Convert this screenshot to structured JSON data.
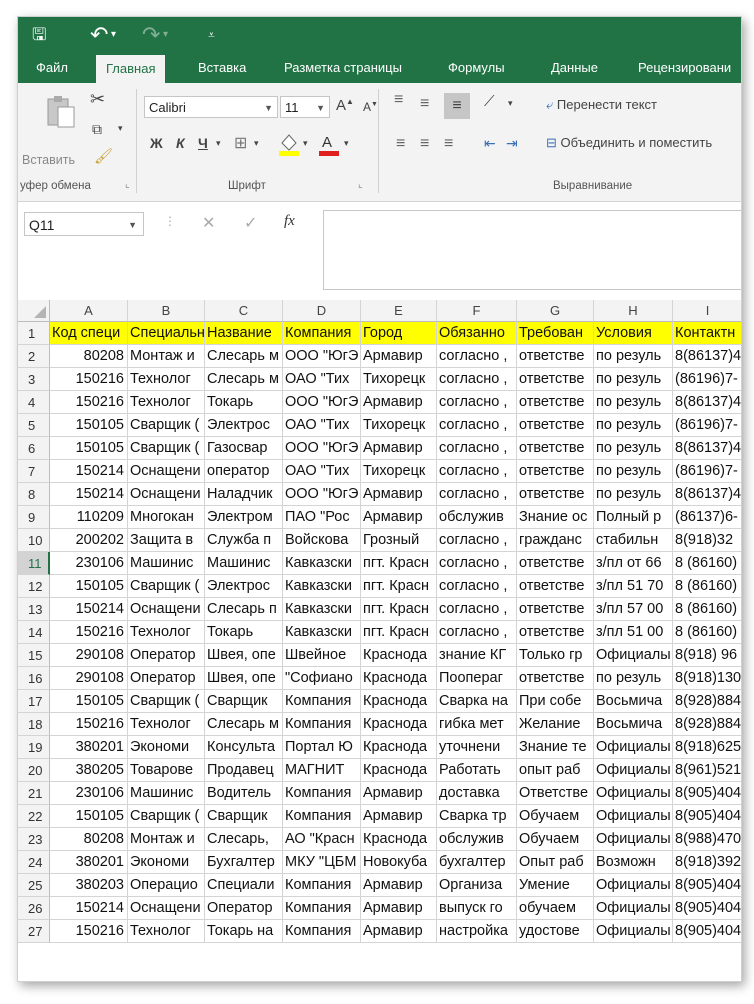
{
  "quick_access": {
    "save": "🖫",
    "undo": "↶",
    "redo": "↷",
    "customize": "▾"
  },
  "tabs": [
    {
      "label": "Файл"
    },
    {
      "label": "Главная"
    },
    {
      "label": "Вставка"
    },
    {
      "label": "Разметка страницы"
    },
    {
      "label": "Формулы"
    },
    {
      "label": "Данные"
    },
    {
      "label": "Рецензировани"
    }
  ],
  "ribbon": {
    "clipboard": {
      "paste_label": "Вставить",
      "group_label": "уфер обмена"
    },
    "font": {
      "font_name": "Calibri",
      "font_size": "11",
      "bold": "Ж",
      "italic": "К",
      "underline": "Ч",
      "grow": "A",
      "shrink": "A",
      "group_label": "Шрифт"
    },
    "alignment": {
      "wrap_text": "Перенести текст",
      "merge_center": "Объединить и поместить",
      "group_label": "Выравнивание"
    }
  },
  "formula_bar": {
    "name_box": "Q11",
    "cancel": "✕",
    "enter": "✓",
    "fx": "fx"
  },
  "grid": {
    "columns": [
      "A",
      "B",
      "C",
      "D",
      "E",
      "F",
      "G",
      "H",
      "I"
    ],
    "selected_row": 11,
    "header_row": [
      "Код специ",
      "Специальн",
      "Название",
      "Компания",
      "Город",
      "Обязанно",
      "Требован",
      "Условия",
      "Контактн"
    ],
    "rows": [
      [
        "80208",
        "Монтаж и",
        "Слесарь м",
        "ООО \"ЮгЭ",
        "Армавир",
        "согласно ,",
        "ответстве",
        "по резуль",
        "8(86137)4"
      ],
      [
        "150216",
        "Технолог",
        "Слесарь м",
        "ОАО \"Тих",
        "Тихорецк",
        "согласно ,",
        "ответстве",
        "по резуль",
        "(86196)7-"
      ],
      [
        "150216",
        "Технолог",
        "Токарь",
        "ООО \"ЮгЭ",
        "Армавир",
        "согласно ,",
        "ответстве",
        "по резуль",
        "8(86137)4"
      ],
      [
        "150105",
        "Сварщик (",
        "Электрос",
        "ОАО \"Тих",
        "Тихорецк",
        "согласно ,",
        "ответстве",
        "по резуль",
        "(86196)7-"
      ],
      [
        "150105",
        "Сварщик (",
        "Газосвар",
        "ООО \"ЮгЭ",
        "Армавир",
        "согласно ,",
        "ответстве",
        "по резуль",
        "8(86137)4"
      ],
      [
        "150214",
        "Оснащени",
        "оператор",
        "ОАО \"Тих",
        "Тихорецк",
        "согласно ,",
        "ответстве",
        "по резуль",
        "(86196)7-"
      ],
      [
        "150214",
        "Оснащени",
        "Наладчик",
        "ООО \"ЮгЭ",
        "Армавир",
        "согласно ,",
        "ответстве",
        "по резуль",
        "8(86137)4"
      ],
      [
        "110209",
        "Многокан",
        "Электром",
        "ПАО \"Рос",
        "Армавир",
        "обслужив",
        "Знание ос",
        "Полный р",
        "(86137)6-"
      ],
      [
        "200202",
        "Защита в",
        "Служба п",
        "Войскова",
        "Грозный",
        "согласно ,",
        "гражданс",
        "стабильн",
        "8(918)32"
      ],
      [
        "230106",
        "Машинис",
        "Машинис",
        "Кавказски",
        "пгт. Красн",
        "согласно ,",
        "ответстве",
        "з/пл от 66",
        "8 (86160)"
      ],
      [
        "150105",
        "Сварщик (",
        "Электрос",
        "Кавказски",
        "пгт. Красн",
        "согласно ,",
        "ответстве",
        "з/пл 51 70",
        "8 (86160)"
      ],
      [
        "150214",
        "Оснащени",
        "Слесарь п",
        "Кавказски",
        "пгт. Красн",
        "согласно ,",
        "ответстве",
        "з/пл 57 00",
        "8 (86160)"
      ],
      [
        "150216",
        "Технолог",
        "Токарь",
        "Кавказски",
        "пгт. Красн",
        "согласно ,",
        "ответстве",
        "з/пл 51 00",
        "8 (86160)"
      ],
      [
        "290108",
        "Оператор",
        "Швея, опе",
        "Швейное",
        "Краснода",
        "знание КГ",
        "Только гр",
        "Официалы",
        "8(918) 96"
      ],
      [
        "290108",
        "Оператор",
        "Швея, опе",
        "\"Софиано",
        "Краснода",
        "Поопераг",
        "ответстве",
        "по резуль",
        "8(918)130"
      ],
      [
        "150105",
        "Сварщик (",
        "Сварщик",
        "Компания",
        "Краснода",
        "Сварка на",
        "При собе",
        "Восьмича",
        "8(928)884"
      ],
      [
        "150216",
        "Технолог",
        "Слесарь м",
        "Компания",
        "Краснода",
        "гибка мет",
        "Желание",
        "Восьмича",
        "8(928)884"
      ],
      [
        "380201",
        "Экономи",
        "Консульта",
        "Портал Ю",
        "Краснода",
        "уточнени",
        "Знание те",
        "Официалы",
        "8(918)625"
      ],
      [
        "380205",
        "Товарове",
        "Продавец",
        "МАГНИТ",
        "Краснода",
        "Работать",
        "опыт раб",
        "Официалы",
        "8(961)521"
      ],
      [
        "230106",
        "Машинис",
        "Водитель",
        "Компания",
        "Армавир",
        "доставка",
        "Ответстве",
        "Официалы",
        "8(905)404"
      ],
      [
        "150105",
        "Сварщик (",
        "Сварщик",
        "Компания",
        "Армавир",
        "Сварка тр",
        "Обучаем",
        "Официалы",
        "8(905)404"
      ],
      [
        "80208",
        "Монтаж и",
        "Слесарь, ",
        "АО \"Красн",
        "Краснода",
        "обслужив",
        "Обучаем",
        "Официалы",
        "8(988)470"
      ],
      [
        "380201",
        "Экономи",
        "Бухгалтер",
        "МКУ \"ЦБМ",
        "Новокуба",
        "бухгалтер",
        "Опыт раб",
        "Возможн",
        "8(918)392"
      ],
      [
        "380203",
        "Операцио",
        "Специали",
        "Компания",
        "Армавир",
        "Организа",
        "Умение",
        "Официалы",
        "8(905)404"
      ],
      [
        "150214",
        "Оснащени",
        "Оператор",
        "Компания",
        "Армавир",
        "выпуск го",
        "обучаем",
        "Официалы",
        "8(905)404"
      ],
      [
        "150216",
        "Технолог",
        "Токарь на",
        "Компания",
        "Армавир",
        "настройка",
        "удостове",
        "Официалы",
        "8(905)404"
      ]
    ]
  }
}
